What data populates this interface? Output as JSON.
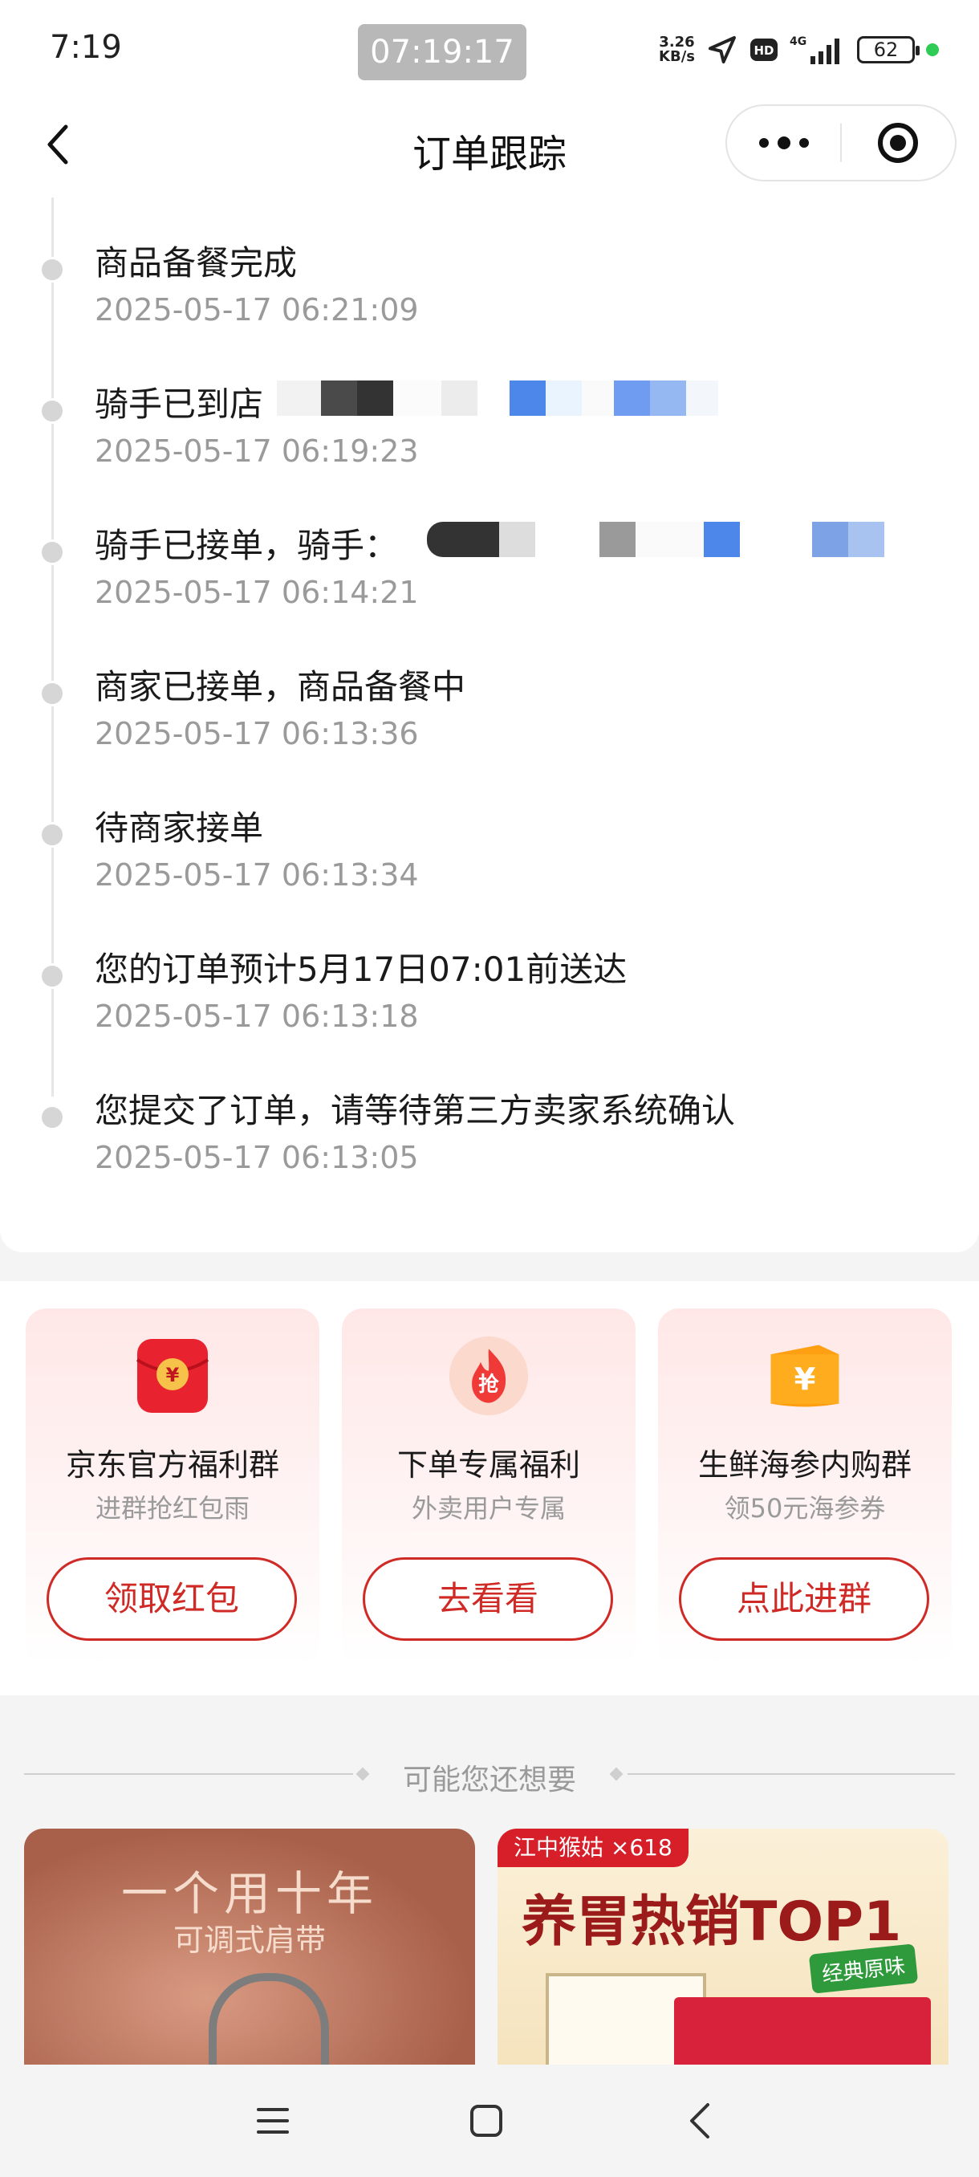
{
  "status_bar": {
    "time": "7:19",
    "clock_pill": "07:19:17",
    "net_speed_value": "3.26",
    "net_speed_unit": "KB/s",
    "battery": "62",
    "icons": [
      "location-arrow-icon",
      "hd-icon",
      "signal-4g-icon",
      "battery-icon",
      "active-dot"
    ]
  },
  "nav": {
    "title": "订单跟踪",
    "back_icon": "chevron-left-icon",
    "more_icon": "more-dots-icon",
    "close_icon": "target-close-icon"
  },
  "timeline": [
    {
      "title": "商品备餐完成",
      "time": "2025-05-17 06:21:09"
    },
    {
      "title": "骑手已到店",
      "time": "2025-05-17 06:19:23"
    },
    {
      "title": "骑手已接单，骑手：",
      "time": "2025-05-17 06:14:21"
    },
    {
      "title": "商家已接单，商品备餐中",
      "time": "2025-05-17 06:13:36"
    },
    {
      "title": "待商家接单",
      "time": "2025-05-17 06:13:34"
    },
    {
      "title": "您的订单预计5月17日07:01前送达",
      "time": "2025-05-17 06:13:18"
    },
    {
      "title": "您提交了订单，请等待第三方卖家系统确认",
      "time": "2025-05-17 06:13:05"
    }
  ],
  "promos": [
    {
      "icon": "red-envelope-yen-icon",
      "title": "京东官方福利群",
      "subtitle": "进群抢红包雨",
      "button": "领取红包"
    },
    {
      "icon": "grab-flame-icon",
      "icon_text": "抢",
      "title": "下单专属福利",
      "subtitle": "外卖用户专属",
      "button": "去看看"
    },
    {
      "icon": "yen-ticket-icon",
      "title": "生鲜海参内购群",
      "subtitle": "领50元海参券",
      "button": "点此进群"
    }
  ],
  "suggest": {
    "heading": "可能您还想要",
    "products": [
      {
        "line1": "一个用十年",
        "line2": "可调式肩带"
      },
      {
        "tag": "江中猴姑 ×618",
        "headline": "养胃热销TOP1",
        "badge": "经典原味"
      }
    ]
  },
  "bottom_nav": [
    "menu-icon",
    "home-square-icon",
    "back-triangle-icon"
  ],
  "colors": {
    "accent": "#cf2a25",
    "dot_gray": "#d6d6d6",
    "time_gray": "#9a9a9a"
  }
}
